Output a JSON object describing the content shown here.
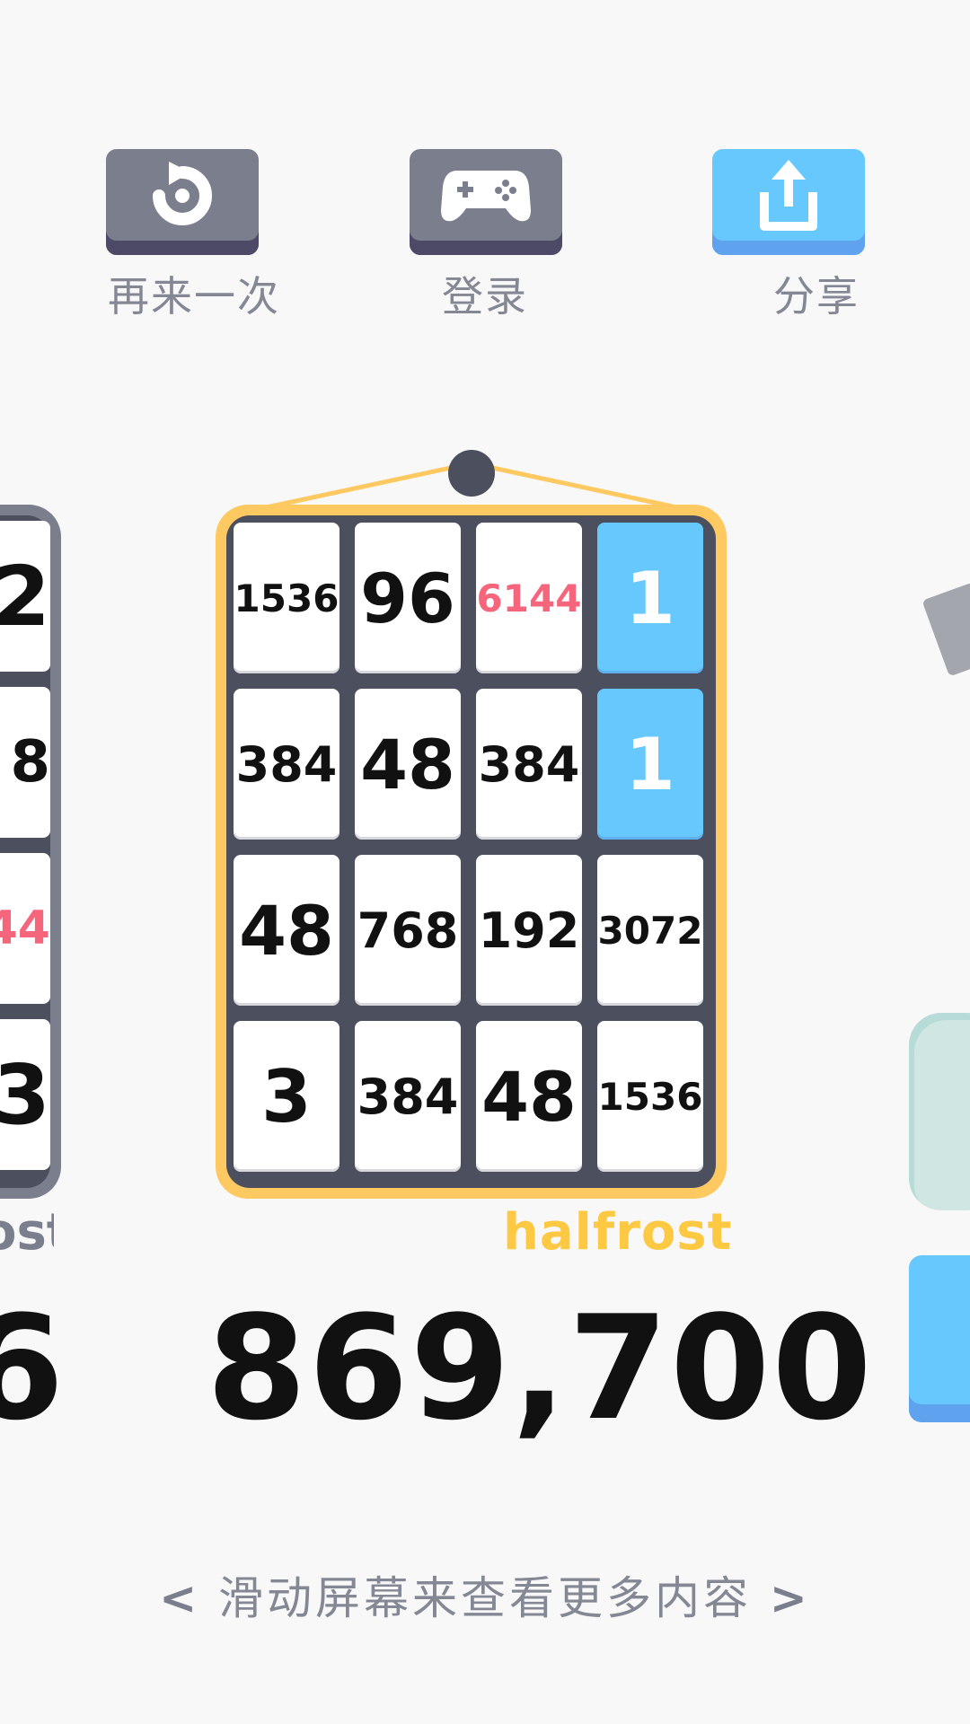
{
  "actions": {
    "replay_label": "再来一次",
    "login_label": "登录",
    "share_label": "分享"
  },
  "board": {
    "tiles": [
      {
        "value": "1536",
        "kind": "white"
      },
      {
        "value": "96",
        "kind": "white"
      },
      {
        "value": "6144",
        "kind": "red"
      },
      {
        "value": "1",
        "kind": "blue"
      },
      {
        "value": "384",
        "kind": "white"
      },
      {
        "value": "48",
        "kind": "white"
      },
      {
        "value": "384",
        "kind": "white"
      },
      {
        "value": "1",
        "kind": "blue"
      },
      {
        "value": "48",
        "kind": "white"
      },
      {
        "value": "768",
        "kind": "white"
      },
      {
        "value": "192",
        "kind": "white"
      },
      {
        "value": "3072",
        "kind": "white"
      },
      {
        "value": "3",
        "kind": "white"
      },
      {
        "value": "384",
        "kind": "white"
      },
      {
        "value": "48",
        "kind": "white"
      },
      {
        "value": "1536",
        "kind": "white"
      }
    ],
    "player_name": "halfrost",
    "score": "869,700"
  },
  "left_board": {
    "tiles": [
      "2",
      "8",
      "44",
      "3"
    ],
    "player_name_fragment": "ost",
    "score_fragment": "6"
  },
  "hint": {
    "left_arrow": "<",
    "text": "滑动屏幕来查看更多内容",
    "right_arrow": ">"
  },
  "colors": {
    "board_frame": "#ffc961",
    "board_inner": "#4b4f5e",
    "blue_tile": "#67c8fd",
    "red_text": "#f5667d",
    "player_name": "#fdc842"
  }
}
